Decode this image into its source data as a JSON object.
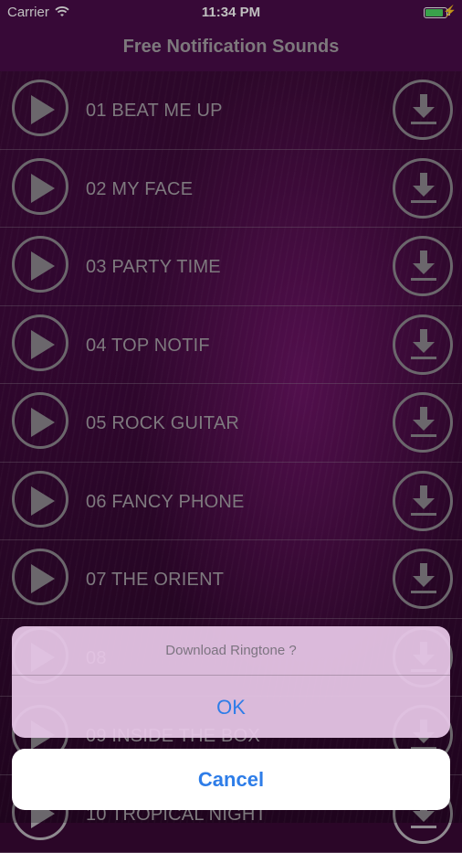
{
  "status_bar": {
    "carrier": "Carrier",
    "time": "11:34 PM",
    "battery_level": 0.85
  },
  "nav": {
    "title": "Free Notification Sounds"
  },
  "sounds": [
    {
      "label": "01 BEAT ME UP"
    },
    {
      "label": "02 MY FACE"
    },
    {
      "label": "03 PARTY TIME"
    },
    {
      "label": "04 TOP NOTIF"
    },
    {
      "label": "05 ROCK GUITAR"
    },
    {
      "label": "06 FANCY PHONE"
    },
    {
      "label": "07 THE ORIENT"
    },
    {
      "label": "08"
    },
    {
      "label": "09 INSIDE THE BOX"
    },
    {
      "label": "10 TROPICAL NIGHT"
    }
  ],
  "action_sheet": {
    "title": "Download Ringtone ?",
    "ok_label": "OK",
    "cancel_label": "Cancel"
  },
  "colors": {
    "accent": "#2e7de8",
    "nav_bg": "#4a0c4a",
    "sheet_bg": "#e8c8e8",
    "battery": "#4cd964"
  }
}
